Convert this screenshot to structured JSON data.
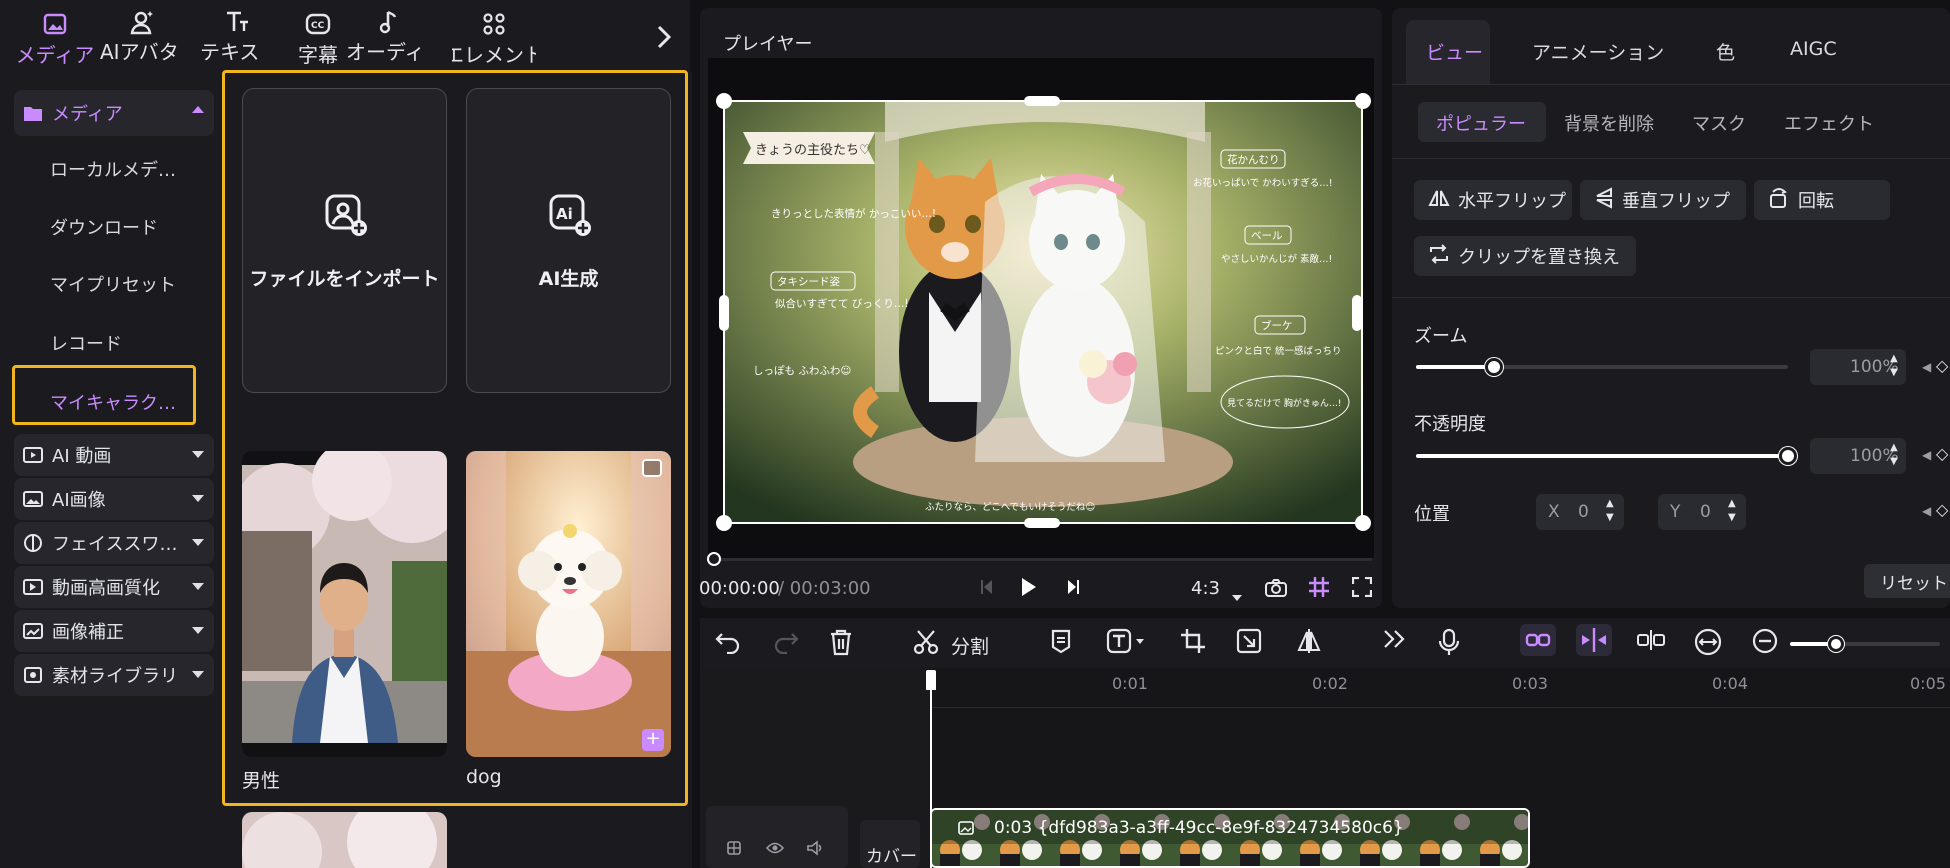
{
  "top_tabs": [
    {
      "label": "メディア",
      "icon": "media-icon"
    },
    {
      "label": "AIアバター",
      "icon": "avatar-icon"
    },
    {
      "label": "テキスト",
      "icon": "text-icon"
    },
    {
      "label": "字幕",
      "icon": "caption-icon"
    },
    {
      "label": "オーディオ",
      "icon": "audio-icon"
    },
    {
      "label": "エレメント",
      "icon": "element-icon"
    }
  ],
  "nav": {
    "media": "メディア",
    "sub": [
      "ローカルメデ…",
      "ダウンロード",
      "マイプリセット",
      "レコード",
      "マイキャラク…"
    ],
    "groups": [
      "AI 動画",
      "AI画像",
      "フェイススワ…",
      "動画高画質化",
      "画像補正",
      "素材ライブラリ"
    ]
  },
  "media": {
    "import_label": "ファイルをインポート",
    "ai_label": "AI生成",
    "items": [
      "男性",
      "dog"
    ]
  },
  "player": {
    "title": "プレイヤー",
    "time_current": "00:00:00",
    "time_total": "/ 00:03:00",
    "ratio": "4:3",
    "image_texts": {
      "banner": "きょうの主役たち♡",
      "n1": "きりっとした表情が かっこいい…!",
      "n2": "タキシード姿",
      "n3": "似合いすぎてて びっくり…!",
      "n4": "しっぽも ふわふわ☺",
      "n5": "花かんむり",
      "n6": "お花いっぱいで かわいすぎる…!",
      "n7": "ベール",
      "n8": "やさしいかんじが 素敵…!",
      "n9": "ブーケ",
      "n10": "ピンクと白で 統一感ばっちり",
      "n11": "見てるだけで 胸がきゅん…!",
      "n12": "ふたりなら、どこへでもいけそうだね☺"
    }
  },
  "right": {
    "tabs": [
      "ビュー",
      "アニメーション",
      "色",
      "AIGC"
    ],
    "subtabs": [
      "ポピュラー",
      "背景を削除",
      "マスク",
      "エフェクト"
    ],
    "buttons": [
      "水平フリップ",
      "垂直フリップ",
      "回転",
      "クリップを置き換え"
    ],
    "zoom_label": "ズーム",
    "zoom_value": "100%",
    "zoom_level": 0.21,
    "opacity_label": "不透明度",
    "opacity_value": "100%",
    "opacity_level": 1.0,
    "position_label": "位置",
    "x_label": "X",
    "x_value": "0",
    "y_label": "Y",
    "y_value": "0",
    "reset_label": "リセット"
  },
  "timeline": {
    "split_label": "分割",
    "ruler": [
      "0:01",
      "0:02",
      "0:03",
      "0:04",
      "0:05"
    ],
    "cover_label": "カバー",
    "clip_label": "0:03 {dfd983a3-a3ff-49cc-8e9f-8324734580c6}"
  },
  "colors": {
    "accent": "#c98bff",
    "highlight": "#f3b51e"
  }
}
